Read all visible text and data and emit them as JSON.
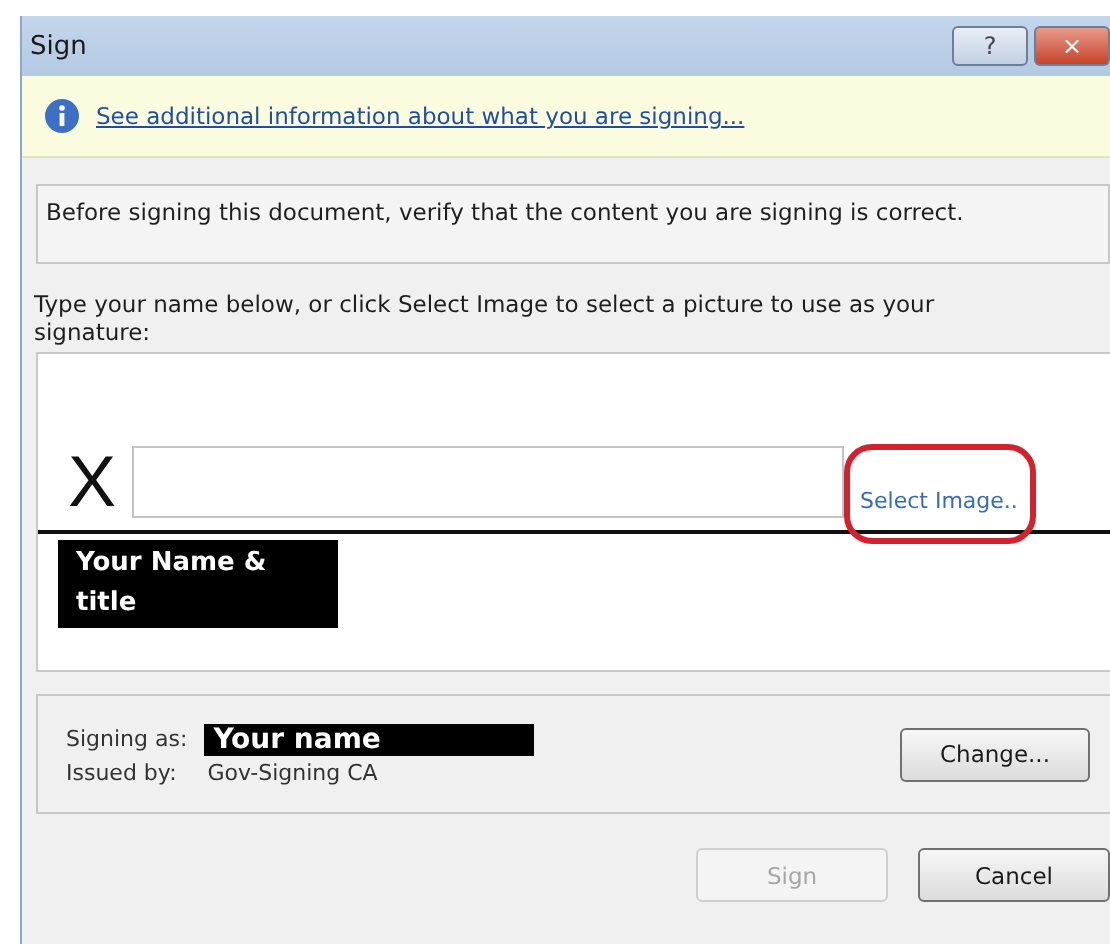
{
  "window": {
    "title": "Sign",
    "controls": [
      "?",
      "×"
    ]
  },
  "info_bar": {
    "link": "See additional information about what you are signing..."
  },
  "notice": "Before signing this document, verify that the content you are signing is correct.",
  "instruction": "Type your name below, or click Select Image to select a picture to use as your signature:",
  "signature": {
    "mark": "X",
    "select_image": "Select Image..",
    "highlighted": true,
    "caption": "Your Name & title"
  },
  "signer": {
    "rows": [
      {
        "label": "Signing as:",
        "value": "Your name",
        "kind": "redacted"
      },
      {
        "label": "Issued by:",
        "value": "Gov-Signing CA",
        "kind": "plain"
      }
    ],
    "change_button": "Change..."
  },
  "buttons": [
    {
      "label": "Sign",
      "disabled": true
    },
    {
      "label": "Cancel",
      "disabled": false
    }
  ]
}
